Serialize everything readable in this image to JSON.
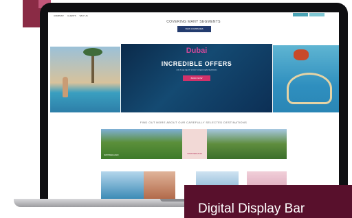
{
  "nav": {
    "links": [
      "COMPANY",
      "CLIENTS",
      "WHY US"
    ]
  },
  "header": {
    "covering": "COVERING MANY SEGMENTS",
    "view_button": "VIEW COMPANIES"
  },
  "hero": {
    "brand": "Dubai",
    "headline": "INCREDIBLE OFFERS",
    "subline": "ON THE NEXT STOP OVER DESTINATION",
    "button": "BOOK NOW"
  },
  "destinations": {
    "heading": "FIND OUT MORE ABOUT OUR CAREFULLY SELECTED DESTINATIONS",
    "pink_label": "SWITZERLAND",
    "caption": "SWITZERLAND"
  },
  "label": {
    "text": "Digital Display Bar"
  },
  "colors": {
    "accent": "#58102c",
    "hero_button": "#d1326a",
    "nav_button": "#4aa3b5"
  }
}
